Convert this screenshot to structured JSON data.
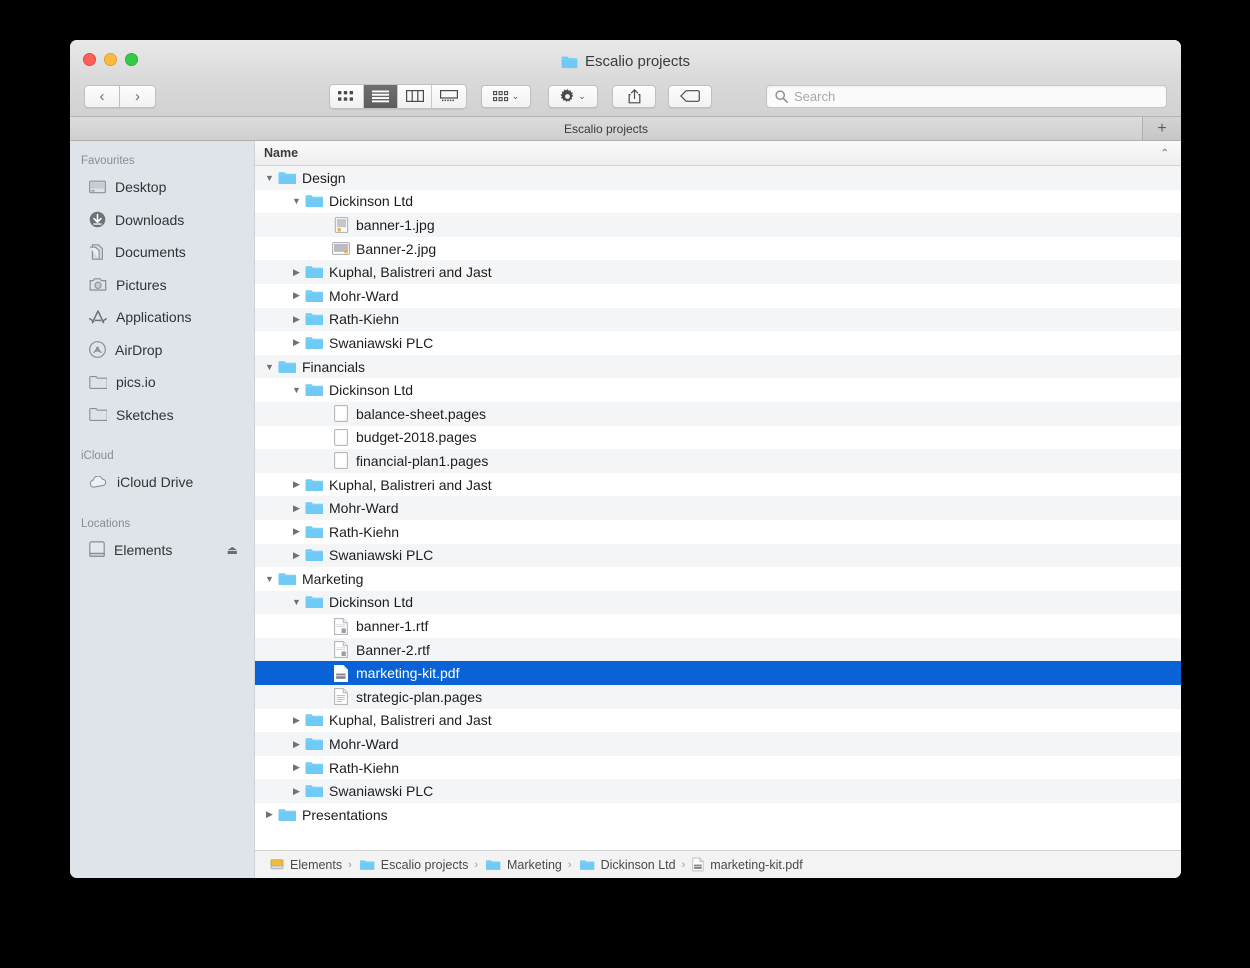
{
  "window": {
    "title": "Escalio projects",
    "traffic_lights": [
      "close",
      "minimize",
      "maximize"
    ]
  },
  "toolbar": {
    "back_label": "‹",
    "forward_label": "›",
    "view_modes": [
      "icon-view",
      "list-view",
      "column-view",
      "gallery-view"
    ],
    "active_view": "list-view",
    "arrange_label": "arrange",
    "action_label": "action",
    "share_label": "share",
    "tag_label": "tag",
    "caret": "⌄"
  },
  "search": {
    "placeholder": "Search",
    "value": ""
  },
  "tabbar": {
    "tab_label": "Escalio projects",
    "new_tab_label": "+"
  },
  "sidebar": {
    "sections": [
      {
        "header": "Favourites",
        "items": [
          {
            "label": "Desktop",
            "icon": "desktop-icon"
          },
          {
            "label": "Downloads",
            "icon": "downloads-icon"
          },
          {
            "label": "Documents",
            "icon": "documents-icon"
          },
          {
            "label": "Pictures",
            "icon": "pictures-icon"
          },
          {
            "label": "Applications",
            "icon": "applications-icon"
          },
          {
            "label": "AirDrop",
            "icon": "airdrop-icon"
          },
          {
            "label": "pics.io",
            "icon": "folder-icon"
          },
          {
            "label": "Sketches",
            "icon": "folder-icon"
          }
        ]
      },
      {
        "header": "iCloud",
        "items": [
          {
            "label": "iCloud Drive",
            "icon": "cloud-icon"
          }
        ]
      },
      {
        "header": "Locations",
        "items": [
          {
            "label": "Elements",
            "icon": "drive-icon",
            "eject": "⏏"
          }
        ]
      }
    ]
  },
  "filelist": {
    "column_header": "Name",
    "sort_indicator": "⌃",
    "rows": [
      {
        "name": "Design",
        "indent": 0,
        "icon": "folder-blue-icon",
        "disclosure": "open",
        "alt": true
      },
      {
        "name": "Dickinson Ltd",
        "indent": 1,
        "icon": "folder-blue-icon",
        "disclosure": "open",
        "alt": false
      },
      {
        "name": "banner-1.jpg",
        "indent": 2,
        "icon": "image-icon",
        "disclosure": "none",
        "alt": true
      },
      {
        "name": "Banner-2.jpg",
        "indent": 2,
        "icon": "image-wide-icon",
        "disclosure": "none",
        "alt": false
      },
      {
        "name": "Kuphal, Balistreri and Jast",
        "indent": 1,
        "icon": "folder-blue-icon",
        "disclosure": "closed",
        "alt": true
      },
      {
        "name": "Mohr-Ward",
        "indent": 1,
        "icon": "folder-blue-icon",
        "disclosure": "closed",
        "alt": false
      },
      {
        "name": "Rath-Kiehn",
        "indent": 1,
        "icon": "folder-blue-icon",
        "disclosure": "closed",
        "alt": true
      },
      {
        "name": "Swaniawski PLC",
        "indent": 1,
        "icon": "folder-blue-icon",
        "disclosure": "closed",
        "alt": false
      },
      {
        "name": "Financials",
        "indent": 0,
        "icon": "folder-blue-icon",
        "disclosure": "open",
        "alt": true
      },
      {
        "name": "Dickinson Ltd",
        "indent": 1,
        "icon": "folder-blue-icon",
        "disclosure": "open",
        "alt": false
      },
      {
        "name": "balance-sheet.pages",
        "indent": 2,
        "icon": "pages-blank-icon",
        "disclosure": "none",
        "alt": true
      },
      {
        "name": "budget-2018.pages",
        "indent": 2,
        "icon": "pages-blank-icon",
        "disclosure": "none",
        "alt": false
      },
      {
        "name": "financial-plan1.pages",
        "indent": 2,
        "icon": "pages-blank-icon",
        "disclosure": "none",
        "alt": true
      },
      {
        "name": "Kuphal, Balistreri and Jast",
        "indent": 1,
        "icon": "folder-blue-icon",
        "disclosure": "closed",
        "alt": false
      },
      {
        "name": "Mohr-Ward",
        "indent": 1,
        "icon": "folder-blue-icon",
        "disclosure": "closed",
        "alt": true
      },
      {
        "name": "Rath-Kiehn",
        "indent": 1,
        "icon": "folder-blue-icon",
        "disclosure": "closed",
        "alt": false
      },
      {
        "name": "Swaniawski PLC",
        "indent": 1,
        "icon": "folder-blue-icon",
        "disclosure": "closed",
        "alt": true
      },
      {
        "name": "Marketing",
        "indent": 0,
        "icon": "folder-blue-icon",
        "disclosure": "open",
        "alt": false
      },
      {
        "name": "Dickinson Ltd",
        "indent": 1,
        "icon": "folder-blue-icon",
        "disclosure": "open",
        "alt": true
      },
      {
        "name": "banner-1.rtf",
        "indent": 2,
        "icon": "rtf-icon",
        "disclosure": "none",
        "alt": false
      },
      {
        "name": "Banner-2.rtf",
        "indent": 2,
        "icon": "rtf-icon",
        "disclosure": "none",
        "alt": true
      },
      {
        "name": "marketing-kit.pdf",
        "indent": 2,
        "icon": "pdf-icon",
        "disclosure": "none",
        "alt": false,
        "selected": true
      },
      {
        "name": "strategic-plan.pages",
        "indent": 2,
        "icon": "pages-icon",
        "disclosure": "none",
        "alt": true
      },
      {
        "name": "Kuphal, Balistreri and Jast",
        "indent": 1,
        "icon": "folder-blue-icon",
        "disclosure": "closed",
        "alt": false
      },
      {
        "name": "Mohr-Ward",
        "indent": 1,
        "icon": "folder-blue-icon",
        "disclosure": "closed",
        "alt": true
      },
      {
        "name": "Rath-Kiehn",
        "indent": 1,
        "icon": "folder-blue-icon",
        "disclosure": "closed",
        "alt": false
      },
      {
        "name": "Swaniawski PLC",
        "indent": 1,
        "icon": "folder-blue-icon",
        "disclosure": "closed",
        "alt": true
      },
      {
        "name": "Presentations",
        "indent": 0,
        "icon": "folder-blue-icon",
        "disclosure": "closed",
        "alt": false
      }
    ],
    "disclosure_open": "▼",
    "disclosure_closed": "▶"
  },
  "pathbar": {
    "separator": "›",
    "items": [
      {
        "label": "Elements",
        "icon": "drive-yellow-icon"
      },
      {
        "label": "Escalio projects",
        "icon": "folder-blue-icon"
      },
      {
        "label": "Marketing",
        "icon": "folder-blue-icon"
      },
      {
        "label": "Dickinson Ltd",
        "icon": "folder-blue-icon"
      },
      {
        "label": "marketing-kit.pdf",
        "icon": "pdf-icon"
      }
    ]
  },
  "colors": {
    "selection_blue": "#0a63d6",
    "folder_blue": "#6fcbf5",
    "sidebar_bg": "#dfe3ea",
    "stripe": "#f4f5f7"
  }
}
